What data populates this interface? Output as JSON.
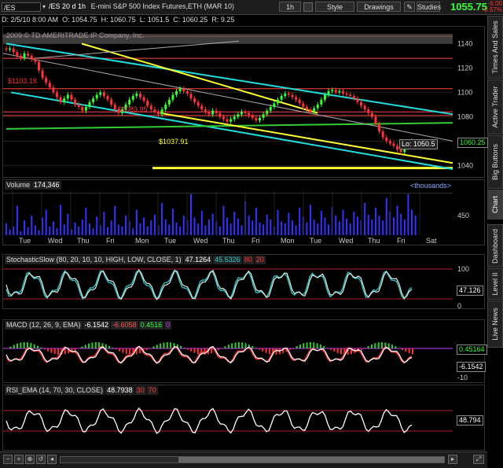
{
  "toolbar": {
    "symbol": "/ES",
    "info": [
      "/ES 20 d 1h",
      "E-mini S&P 500 Index Futures,ETH (MAR 10)"
    ],
    "quote": {
      "D": "D: 2/5/10 8:00 AM",
      "O": "O: 1054.75",
      "H": "H: 1060.75",
      "L": "L: 1051.5",
      "C": "C: 1060.25",
      "R": "R: 9.25"
    },
    "interval": "1h",
    "style_label": "Style",
    "drawings_label": "Drawings",
    "studies_label": "Studies",
    "last_price": "1055.75",
    "change_pts": "-6.00",
    "change_pct": "-0.57%",
    "colors": {
      "up": "#33ff33",
      "down": "#ff3333"
    }
  },
  "side_tabs": [
    "Times And Sales",
    "Active Trader",
    "Big Buttons",
    "Chart",
    "Dashboard",
    "Level II",
    "Live News"
  ],
  "active_tab": "Chart",
  "price_panel": {
    "watermark": "2009 © TD AMERITRADE IP Company, Inc.",
    "price_axis": [
      "1140",
      "1120",
      "1100",
      "1080",
      "1060",
      "1040"
    ],
    "level_labels": {
      "a": "$1103.18",
      "b": "$1083.95",
      "c": "$1037.91"
    },
    "last_label": "1060.25",
    "low_label": "Lo: 1050.5"
  },
  "volume_panel": {
    "title": "Volume",
    "value": "174,346",
    "units": "<thousands>",
    "axis": [
      "450"
    ],
    "day_labels": [
      "Tue",
      "Wed",
      "Thu",
      "Fri",
      "Mon",
      "Tue",
      "Wed",
      "Thu",
      "Fri",
      "Mon",
      "Tue",
      "Wed",
      "Thu",
      "Fri",
      "Sat"
    ]
  },
  "stoch_panel": {
    "title": "StochasticSlow (80, 20, 10, 10, HIGH, LOW, CLOSE, 1)",
    "v1": "47.1264",
    "v2": "45.5326",
    "v3": "80",
    "v4": "20",
    "axis": [
      "100",
      "47.126",
      "0"
    ]
  },
  "macd_panel": {
    "title": "MACD (12, 26, 9, EMA)",
    "v1": "-6.1542",
    "v2": "-6.6058",
    "v3": "0.4516",
    "v4": "0",
    "axis": [
      "0.45164",
      "-6.1542",
      "-10"
    ]
  },
  "rsi_panel": {
    "title": "RSI_EMA (14, 70, 30, CLOSE)",
    "v1": "48.7938",
    "v2": "30",
    "v3": "70",
    "axis": [
      "48.794"
    ]
  },
  "chart_data": {
    "type": "line",
    "x_labels": [
      "Tue",
      "Wed",
      "Thu",
      "Fri",
      "Mon",
      "Tue",
      "Wed",
      "Thu",
      "Fri",
      "Mon",
      "Tue",
      "Wed",
      "Thu",
      "Fri",
      "Sat"
    ],
    "ylim": [
      1037,
      1150
    ],
    "close": [
      1135,
      1136,
      1133,
      1130,
      1128,
      1132,
      1130,
      1127,
      1125,
      1118,
      1112,
      1108,
      1104,
      1100,
      1096,
      1092,
      1095,
      1098,
      1094,
      1090,
      1088,
      1085,
      1088,
      1092,
      1095,
      1098,
      1100,
      1097,
      1094,
      1090,
      1086,
      1083,
      1086,
      1090,
      1094,
      1097,
      1099,
      1096,
      1093,
      1089,
      1086,
      1084,
      1082,
      1086,
      1090,
      1094,
      1098,
      1101,
      1103,
      1101,
      1099,
      1095,
      1092,
      1089,
      1086,
      1084,
      1082,
      1085,
      1083,
      1080,
      1078,
      1076,
      1078,
      1080,
      1082,
      1084,
      1083,
      1081,
      1079,
      1077,
      1079,
      1082,
      1085,
      1088,
      1091,
      1094,
      1097,
      1099,
      1098,
      1096,
      1094,
      1091,
      1088,
      1086,
      1084,
      1087,
      1090,
      1094,
      1098,
      1101,
      1102,
      1100,
      1101,
      1099,
      1098,
      1097,
      1095,
      1092,
      1089,
      1086,
      1083,
      1080,
      1074,
      1068,
      1063,
      1060,
      1058,
      1056,
      1053,
      1051,
      1055,
      1058,
      1060
    ],
    "volume": [
      120,
      60,
      90,
      300,
      40,
      150,
      80,
      200,
      100,
      50,
      180,
      260,
      90,
      140,
      70,
      310,
      110,
      220,
      60,
      130,
      90,
      160,
      280,
      120,
      70,
      190,
      100,
      240,
      80,
      150,
      300,
      110,
      90,
      200,
      140,
      70,
      260,
      120,
      180,
      90,
      150,
      210,
      100,
      330,
      160,
      110,
      270,
      130,
      90,
      200,
      150,
      420,
      180,
      120,
      250,
      100,
      160,
      220,
      140,
      90,
      300,
      180,
      120,
      240,
      170,
      100,
      350,
      200,
      150,
      280,
      130,
      110,
      210,
      160,
      90,
      260,
      140,
      120,
      230,
      150,
      100,
      280,
      190,
      130,
      310,
      160,
      120,
      250,
      180,
      110,
      290,
      200,
      140,
      260,
      170,
      120,
      240,
      190,
      150,
      330,
      210,
      160,
      280,
      200,
      150,
      380,
      240,
      180,
      300,
      220,
      160,
      420,
      260,
      200
    ]
  }
}
